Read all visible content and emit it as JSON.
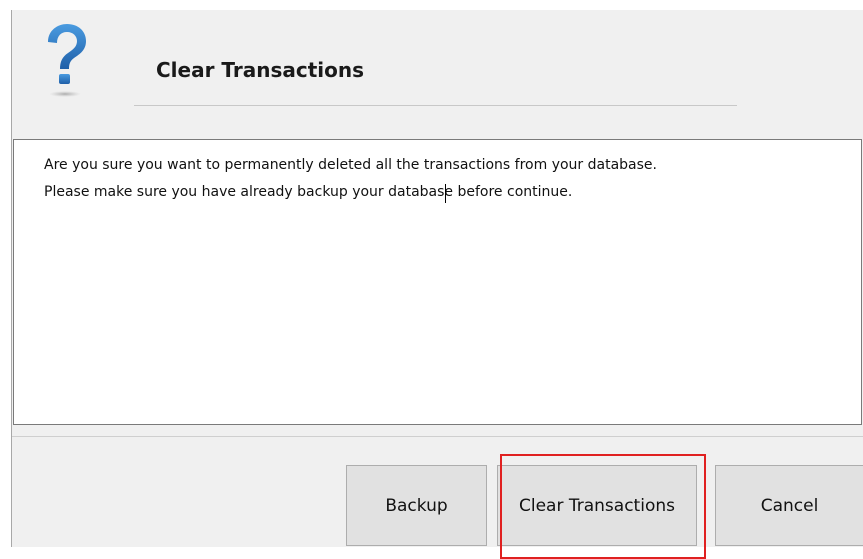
{
  "dialog": {
    "title": "Clear Transactions",
    "icon": "question-mark-icon",
    "message_lines": [
      "Are you sure you want to permanently deleted all the transactions from your database.",
      "Please make sure you have already backup your database before continue."
    ]
  },
  "buttons": {
    "backup_label": "Backup",
    "clear_label": "Clear Transactions",
    "cancel_label": "Cancel"
  },
  "colors": {
    "icon_blue": "#2b78c2",
    "highlight": "#e02020",
    "dialog_bg": "#f0f0f0"
  }
}
